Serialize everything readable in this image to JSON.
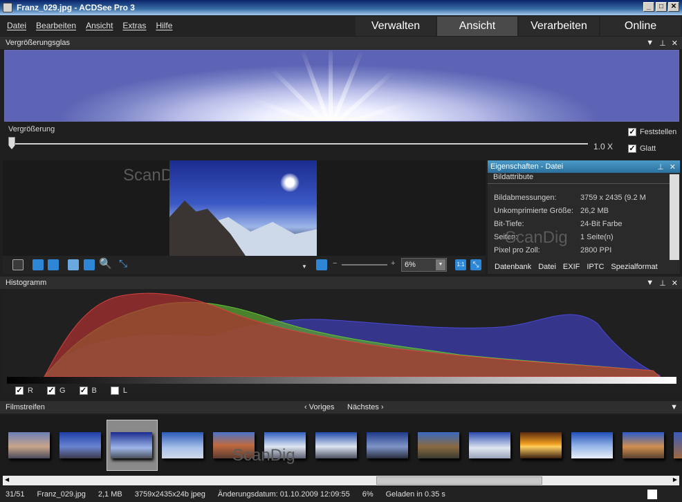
{
  "window": {
    "title": "Franz_029.jpg - ACDSee Pro 3",
    "min": "_",
    "max": "□",
    "close": "✕"
  },
  "menu": [
    "Datei",
    "Bearbeiten",
    "Ansicht",
    "Extras",
    "Hilfe"
  ],
  "modes": [
    "Verwalten",
    "Ansicht",
    "Verarbeiten",
    "Online"
  ],
  "magnifier": {
    "title": "Vergrößerungsglas",
    "zoom_label": "Vergrößerung",
    "zoom_value": "1.0 X",
    "lock_label": "Feststellen",
    "smooth_label": "Glatt",
    "zoom_level": 0.0
  },
  "preview": {
    "watermark": "ScanDig",
    "zoom": "6%",
    "actual_size": "1:1"
  },
  "properties": {
    "title": "Eigenschaften - Datei",
    "section": "Bildattribute",
    "rows": [
      {
        "k": "Bildabmessungen:",
        "v": "3759 x 2435 (9.2 M"
      },
      {
        "k": "Unkomprimierte Größe:",
        "v": "26,2 MB"
      },
      {
        "k": "Bit-Tiefe:",
        "v": "24-Bit Farbe"
      },
      {
        "k": "Seiten:",
        "v": "1 Seite(n)"
      },
      {
        "k": "Pixel pro Zoll:",
        "v": "2800 PPI"
      }
    ],
    "tabs": [
      "Datenbank",
      "Datei",
      "EXIF",
      "IPTC",
      "Spezialformat"
    ],
    "watermark": "ScanDig"
  },
  "histogram": {
    "title": "Histogramm",
    "channels": [
      "R",
      "G",
      "B",
      "L"
    ],
    "colors": {
      "red": "#b03030",
      "green": "#5aa030",
      "blue": "#3a3aa0"
    }
  },
  "filmstrip": {
    "title": "Filmstreifen",
    "prev": "Voriges",
    "next": "Nächstes",
    "watermark": "ScanDig"
  },
  "status": {
    "index": "31/51",
    "file": "Franz_029.jpg",
    "size": "2,1 MB",
    "dims": "3759x2435x24b jpeg",
    "modified": "Änderungsdatum: 01.10.2009 12:09:55",
    "zoom": "6%",
    "loaded": "Geladen in 0.35 s"
  }
}
